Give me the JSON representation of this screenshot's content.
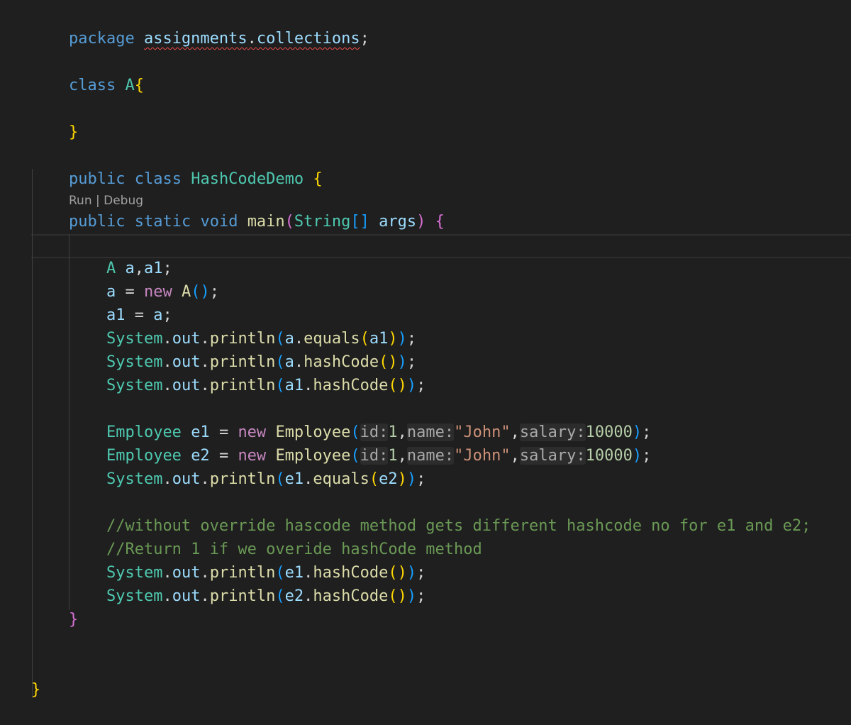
{
  "editor": {
    "codelens": "Run | Debug",
    "lines": {
      "l1": {
        "t1": "package",
        "t2": "assignments",
        "t3": ".",
        "t4": "collections",
        "t5": ";"
      },
      "l2": {
        "t1": "class",
        "t2": "A",
        "t3": "{"
      },
      "l3": {
        "t1": "}"
      },
      "l4": {
        "t1": "public",
        "t2": "class",
        "t3": "HashCodeDemo",
        "t4": "{"
      },
      "l5": {
        "t1": "public",
        "t2": "static",
        "t3": "void",
        "t4": "main",
        "t5": "(",
        "t6": "String",
        "t7": "[]",
        "t8": "args",
        "t9": ")",
        "t10": "{"
      },
      "l6": {
        "t1": "A",
        "t2": "a",
        "t3": ",",
        "t4": "a1",
        "t5": ";"
      },
      "l7": {
        "t1": "a",
        "t2": "=",
        "t3": "new",
        "t4": "A",
        "t5": "()",
        "t6": ";"
      },
      "l8": {
        "t1": "a1",
        "t2": "=",
        "t3": "a",
        "t4": ";"
      },
      "l9": {
        "t1": "System",
        "t2": ".",
        "t3": "out",
        "t4": ".",
        "t5": "println",
        "t6": "(",
        "t7": "a",
        "t8": ".",
        "t9": "equals",
        "t10": "(",
        "t11": "a1",
        "t12": ")",
        "t13": ")",
        "t14": ";"
      },
      "l10": {
        "t1": "System",
        "t2": ".",
        "t3": "out",
        "t4": ".",
        "t5": "println",
        "t6": "(",
        "t7": "a",
        "t8": ".",
        "t9": "hashCode",
        "t10": "()",
        "t11": ")",
        "t12": ";"
      },
      "l11": {
        "t1": "System",
        "t2": ".",
        "t3": "out",
        "t4": ".",
        "t5": "println",
        "t6": "(",
        "t7": "a1",
        "t8": ".",
        "t9": "hashCode",
        "t10": "()",
        "t11": ")",
        "t12": ";"
      },
      "l12": {
        "t1": "Employee",
        "t2": "e1",
        "t3": "=",
        "t4": "new",
        "t5": "Employee",
        "t6": "(",
        "t7": "id:",
        "t8": "1",
        "t9": ",",
        "t10": "name:",
        "t11": "\"John\"",
        "t12": ",",
        "t13": "salary:",
        "t14": "10000",
        "t15": ")",
        "t16": ";"
      },
      "l13": {
        "t1": "Employee",
        "t2": "e2",
        "t3": "=",
        "t4": "new",
        "t5": "Employee",
        "t6": "(",
        "t7": "id:",
        "t8": "1",
        "t9": ",",
        "t10": "name:",
        "t11": "\"John\"",
        "t12": ",",
        "t13": "salary:",
        "t14": "10000",
        "t15": ")",
        "t16": ";"
      },
      "l14": {
        "t1": "System",
        "t2": ".",
        "t3": "out",
        "t4": ".",
        "t5": "println",
        "t6": "(",
        "t7": "e1",
        "t8": ".",
        "t9": "equals",
        "t10": "(",
        "t11": "e2",
        "t12": ")",
        "t13": ")",
        "t14": ";"
      },
      "l15": {
        "t1": "//without override hascode method gets different hashcode no for e1 and e2;"
      },
      "l16": {
        "t1": "//Return 1 if we overide hashCode method"
      },
      "l17": {
        "t1": "System",
        "t2": ".",
        "t3": "out",
        "t4": ".",
        "t5": "println",
        "t6": "(",
        "t7": "e1",
        "t8": ".",
        "t9": "hashCode",
        "t10": "()",
        "t11": ")",
        "t12": ";"
      },
      "l18": {
        "t1": "System",
        "t2": ".",
        "t3": "out",
        "t4": ".",
        "t5": "println",
        "t6": "(",
        "t7": "e2",
        "t8": ".",
        "t9": "hashCode",
        "t10": "()",
        "t11": ")",
        "t12": ";"
      },
      "l19": {
        "t1": "}"
      },
      "l20": {
        "t1": "}"
      }
    }
  },
  "colors": {
    "background": "#1f1f1f",
    "keyword": "#569cd6",
    "control_keyword": "#c586c0",
    "type": "#4ec9b0",
    "function": "#dcdcaa",
    "variable": "#9cdcfe",
    "number": "#b5cea8",
    "string": "#ce9178",
    "comment": "#6a9955",
    "bracket_level1": "#ffd700",
    "bracket_level2": "#da70d6",
    "bracket_level3": "#179fff",
    "error_squiggle": "#f14c4c"
  }
}
